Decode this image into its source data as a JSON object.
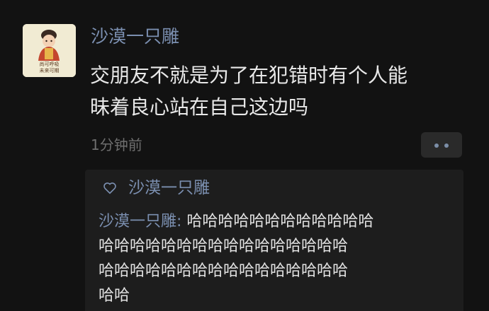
{
  "post": {
    "author": "沙漠一只雕",
    "avatar_text": [
      "尚可呼吸",
      "未来可期"
    ],
    "content_lines": [
      "交朋友不就是为了在犯错时有个人能",
      "昧着良心站在自己这边吗"
    ],
    "time": "1分钟前",
    "more_icon": "more-dots-icon"
  },
  "likes": {
    "icon": "heart-outline-icon",
    "names": "沙漠一只雕"
  },
  "comment": {
    "author": "沙漠一只雕:",
    "text_lines": [
      " 哈哈哈哈哈哈哈哈哈哈哈哈",
      "哈哈哈哈哈哈哈哈哈哈哈哈哈哈哈哈",
      "哈哈哈哈哈哈哈哈哈哈哈哈哈哈哈哈",
      "哈哈"
    ]
  },
  "colors": {
    "background": "#121212",
    "name_link": "#7b8fb0",
    "comment_box": "#1d1d1d",
    "text": "#e8e8e8",
    "muted": "#6e6e6e"
  }
}
